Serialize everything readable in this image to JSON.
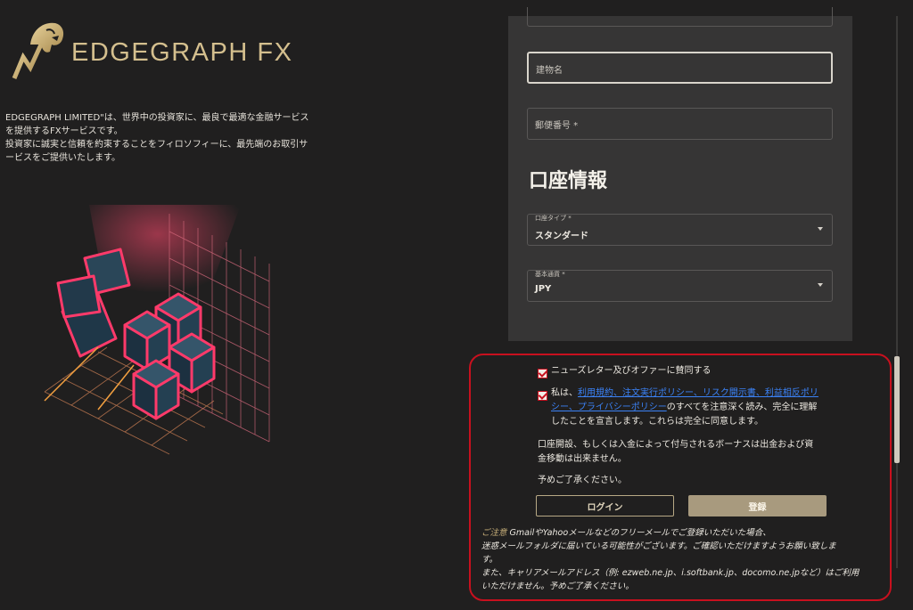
{
  "brand": {
    "name": "EDGEGRAPH FX"
  },
  "intro": {
    "line1": "EDGEGRAPH LIMITED\"は、世界中の投資家に、最良で最適な金融サービス",
    "line2": "を提供するFXサービスです。",
    "line3": "投資家に誠実と信頼を約束することをフィロソフィーに、最先端のお取引サ",
    "line4": "ービスをご提供いたします。"
  },
  "form": {
    "building_placeholder": "建物名",
    "postal_placeholder": "郵便番号 *",
    "account_section_title": "口座情報",
    "account_type": {
      "label": "口座タイプ *",
      "value": "スタンダード"
    },
    "base_currency": {
      "label": "基本通貨 *",
      "value": "JPY"
    }
  },
  "consent": {
    "newsletter_label": "ニューズレター及びオファーに賛同する",
    "terms_prefix": "私は、",
    "terms_links_line1": "利用規約、注文実行ポリシー、リスク開示書、利益相反ポリ",
    "terms_links_line2": "シー、プライバシーポリシー",
    "terms_suffix_line2": "のすべてを注意深く読み、完全に理解",
    "terms_line3": "したことを宣言します。これらは完全に同意します。",
    "bonus_line1": "口座開設、もしくは入金によって付与されるボーナスは出金および資",
    "bonus_line2": "金移動は出来ません。",
    "acknowledge": "予めご了承ください。",
    "login_label": "ログイン",
    "register_label": "登録"
  },
  "notice": {
    "caution_label": "ご注意",
    "line1": " GmailやYahooメールなどのフリーメールでご登録いただいた場合、",
    "line2": "迷惑メールフォルダに届いている可能性がございます。ご確認いただけますようお願い致しま",
    "line3": "す。",
    "line4": "また、キャリアメールアドレス（例: ezweb.ne.jp、i.softbank.jp、docomo.ne.jpなど）はご利用",
    "line5": "いただけません。予めご了承ください。"
  },
  "colors": {
    "accent_gold": "#d4bf8e",
    "highlight_red": "#c8101e",
    "link_blue": "#3b82f6",
    "register_button": "#a89a7e"
  }
}
